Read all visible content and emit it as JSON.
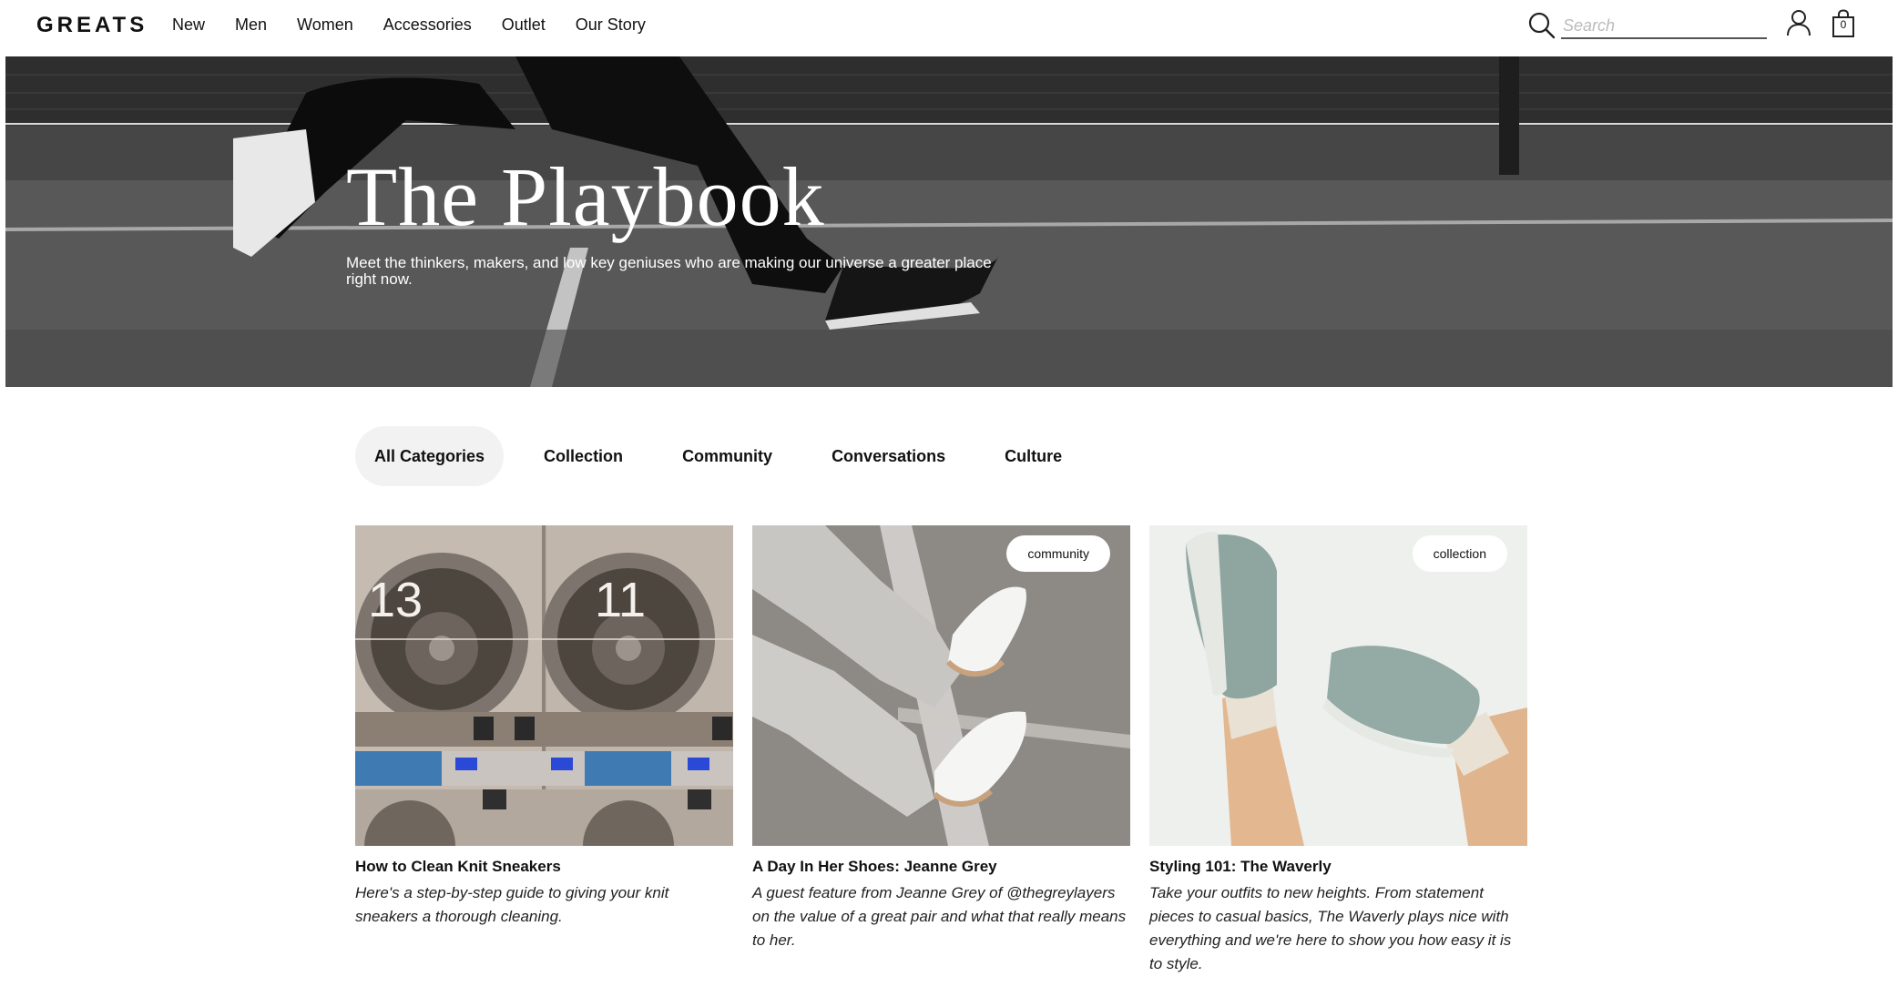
{
  "header": {
    "logo": "GREATS",
    "nav": [
      "New",
      "Men",
      "Women",
      "Accessories",
      "Outlet",
      "Our Story"
    ],
    "search_placeholder": "Search",
    "bag_count": "0"
  },
  "hero": {
    "title": "The Playbook",
    "subtitle": "Meet the thinkers, makers, and low key geniuses who are making our universe a greater place right now."
  },
  "categories": {
    "items": [
      "All Categories",
      "Collection",
      "Community",
      "Conversations",
      "Culture"
    ],
    "active": "All Categories"
  },
  "articles": [
    {
      "title": "How to Clean Knit Sneakers",
      "description": "Here's a step-by-step guide to giving your knit sneakers a thorough cleaning.",
      "badge": "",
      "image_text": [
        "13",
        "11"
      ]
    },
    {
      "title": "A Day In Her Shoes: Jeanne Grey",
      "description": "A guest feature from Jeanne Grey of @thegreylayers on the value of a great pair and what that really means to her.",
      "badge": "community"
    },
    {
      "title": "Styling 101: The Waverly",
      "description": "Take your outfits to new heights. From statement pieces to casual basics, The Waverly plays nice with everything and we're here to show you how easy it is to style.",
      "badge": "collection"
    }
  ],
  "icons": {
    "search": "search-icon",
    "account": "account-icon",
    "bag": "shopping-bag-icon"
  }
}
